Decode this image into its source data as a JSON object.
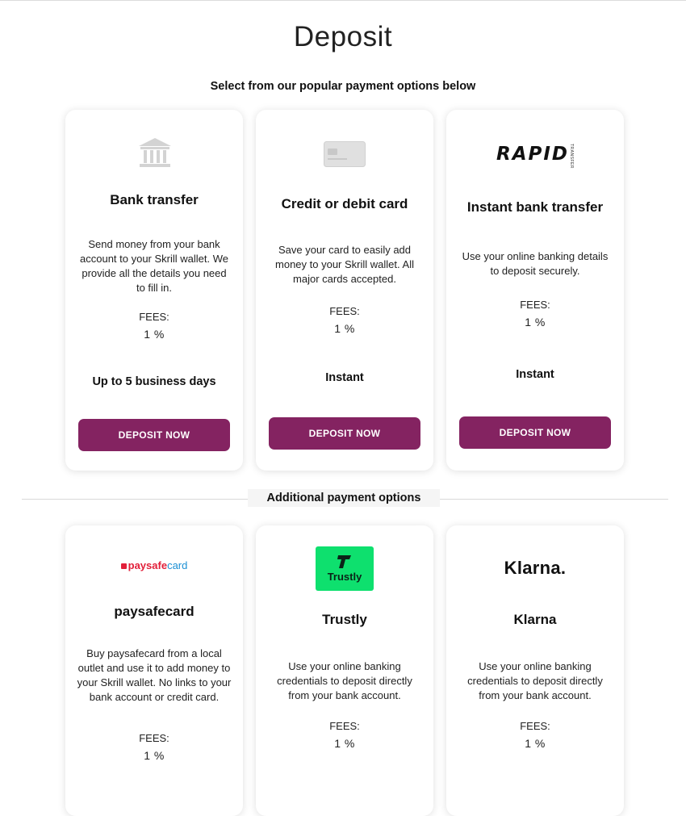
{
  "page": {
    "title": "Deposit",
    "subtitle": "Select from our popular payment options below",
    "additional_label": "Additional payment options"
  },
  "colors": {
    "button": "#842361",
    "trustly": "#0ee06e",
    "paysafe_red": "#e2203a",
    "paysafe_blue": "#1a8fd4"
  },
  "popular": [
    {
      "icon": "bank-icon",
      "title": "Bank transfer",
      "description": "Send money from your bank account to your Skrill wallet. We provide all the details you need to fill in.",
      "fees_label": "FEES:",
      "fees_value": "1 %",
      "timing": "Up to 5 business days",
      "button": "DEPOSIT NOW"
    },
    {
      "icon": "credit-card-icon",
      "title": "Credit or debit card",
      "description": "Save your card to easily add money to your Skrill wallet. All major cards accepted.",
      "fees_label": "FEES:",
      "fees_value": "1 %",
      "timing": "Instant",
      "button": "DEPOSIT NOW"
    },
    {
      "icon": "rapid-transfer-logo",
      "logo_text": "RAPID",
      "logo_subtext": "TRANSFER",
      "title": "Instant bank transfer",
      "description": "Use your online banking details to deposit securely.",
      "fees_label": "FEES:",
      "fees_value": "1 %",
      "timing": "Instant",
      "button": "DEPOSIT NOW"
    }
  ],
  "additional": [
    {
      "icon": "paysafecard-logo",
      "logo_text_a": "paysafe",
      "logo_text_b": "card",
      "title": "paysafecard",
      "description": "Buy paysafecard from a local outlet and use it to add money to your Skrill wallet. No links to your bank account or credit card.",
      "fees_label": "FEES:",
      "fees_value": "1 %"
    },
    {
      "icon": "trustly-logo",
      "logo_text": "Trustly",
      "title": "Trustly",
      "description": "Use your online banking credentials to deposit directly from your bank account.",
      "fees_label": "FEES:",
      "fees_value": "1 %"
    },
    {
      "icon": "klarna-logo",
      "logo_text": "Klarna.",
      "title": "Klarna",
      "description": "Use your online banking credentials to deposit directly from your bank account.",
      "fees_label": "FEES:",
      "fees_value": "1 %"
    }
  ]
}
